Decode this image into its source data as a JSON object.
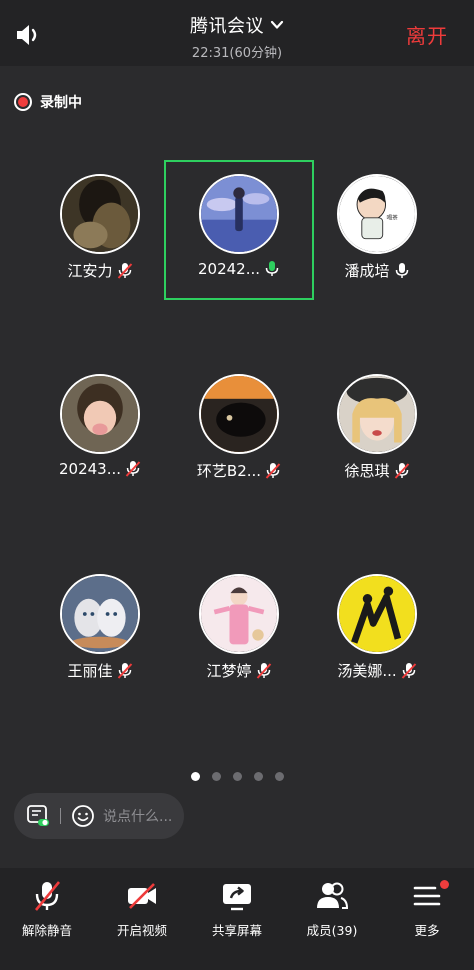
{
  "header": {
    "title": "腾讯会议",
    "subtitle": "22:31(60分钟)",
    "leave_label": "离开"
  },
  "recording": {
    "label": "录制中"
  },
  "participants": [
    {
      "name": "江安力",
      "mic": "muted",
      "active": false,
      "avatar": "dark-portrait"
    },
    {
      "name": "20242...",
      "mic": "speaking",
      "active": true,
      "avatar": "sky-figure"
    },
    {
      "name": "潘成培",
      "mic": "on",
      "active": false,
      "avatar": "cartoon-face"
    },
    {
      "name": "20243...",
      "mic": "muted",
      "active": false,
      "avatar": "child-photo"
    },
    {
      "name": "环艺B2...",
      "mic": "muted",
      "active": false,
      "avatar": "black-cat"
    },
    {
      "name": "徐思琪",
      "mic": "muted",
      "active": false,
      "avatar": "girl-hat"
    },
    {
      "name": "王丽佳",
      "mic": "muted",
      "active": false,
      "avatar": "kittens"
    },
    {
      "name": "江梦婷",
      "mic": "muted",
      "active": false,
      "avatar": "pink-illustration"
    },
    {
      "name": "汤美娜...",
      "mic": "muted",
      "active": false,
      "avatar": "yellow-dancers"
    }
  ],
  "pagination": {
    "count": 5,
    "current": 1
  },
  "chat": {
    "placeholder": "说点什么..."
  },
  "toolbar": {
    "unmute": "解除静音",
    "video": "开启视频",
    "share": "共享屏幕",
    "members": "成员(39)",
    "more": "更多"
  },
  "colors": {
    "accent_red": "#ee3b3b",
    "speaking_green": "#2ecf5f",
    "background": "#2b2b2d"
  }
}
